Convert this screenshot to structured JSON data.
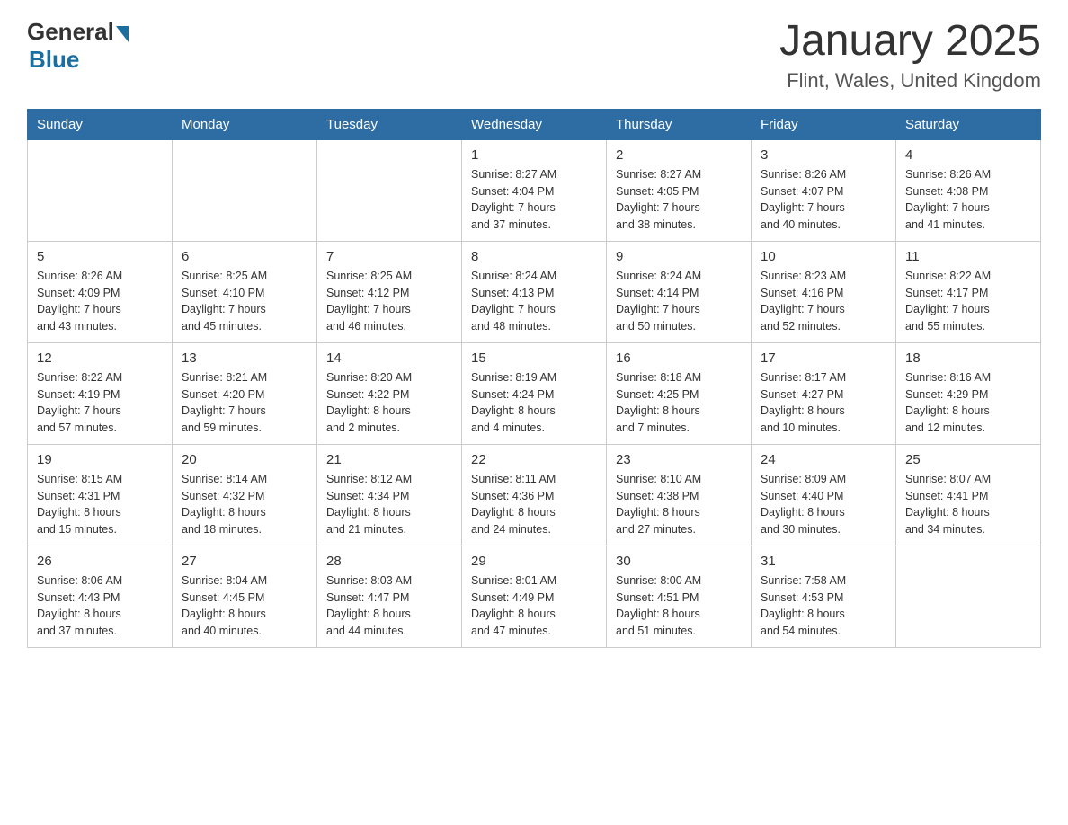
{
  "header": {
    "logo_general": "General",
    "logo_blue": "Blue",
    "title": "January 2025",
    "subtitle": "Flint, Wales, United Kingdom"
  },
  "calendar": {
    "days_of_week": [
      "Sunday",
      "Monday",
      "Tuesday",
      "Wednesday",
      "Thursday",
      "Friday",
      "Saturday"
    ],
    "weeks": [
      [
        {
          "day": "",
          "info": ""
        },
        {
          "day": "",
          "info": ""
        },
        {
          "day": "",
          "info": ""
        },
        {
          "day": "1",
          "info": "Sunrise: 8:27 AM\nSunset: 4:04 PM\nDaylight: 7 hours\nand 37 minutes."
        },
        {
          "day": "2",
          "info": "Sunrise: 8:27 AM\nSunset: 4:05 PM\nDaylight: 7 hours\nand 38 minutes."
        },
        {
          "day": "3",
          "info": "Sunrise: 8:26 AM\nSunset: 4:07 PM\nDaylight: 7 hours\nand 40 minutes."
        },
        {
          "day": "4",
          "info": "Sunrise: 8:26 AM\nSunset: 4:08 PM\nDaylight: 7 hours\nand 41 minutes."
        }
      ],
      [
        {
          "day": "5",
          "info": "Sunrise: 8:26 AM\nSunset: 4:09 PM\nDaylight: 7 hours\nand 43 minutes."
        },
        {
          "day": "6",
          "info": "Sunrise: 8:25 AM\nSunset: 4:10 PM\nDaylight: 7 hours\nand 45 minutes."
        },
        {
          "day": "7",
          "info": "Sunrise: 8:25 AM\nSunset: 4:12 PM\nDaylight: 7 hours\nand 46 minutes."
        },
        {
          "day": "8",
          "info": "Sunrise: 8:24 AM\nSunset: 4:13 PM\nDaylight: 7 hours\nand 48 minutes."
        },
        {
          "day": "9",
          "info": "Sunrise: 8:24 AM\nSunset: 4:14 PM\nDaylight: 7 hours\nand 50 minutes."
        },
        {
          "day": "10",
          "info": "Sunrise: 8:23 AM\nSunset: 4:16 PM\nDaylight: 7 hours\nand 52 minutes."
        },
        {
          "day": "11",
          "info": "Sunrise: 8:22 AM\nSunset: 4:17 PM\nDaylight: 7 hours\nand 55 minutes."
        }
      ],
      [
        {
          "day": "12",
          "info": "Sunrise: 8:22 AM\nSunset: 4:19 PM\nDaylight: 7 hours\nand 57 minutes."
        },
        {
          "day": "13",
          "info": "Sunrise: 8:21 AM\nSunset: 4:20 PM\nDaylight: 7 hours\nand 59 minutes."
        },
        {
          "day": "14",
          "info": "Sunrise: 8:20 AM\nSunset: 4:22 PM\nDaylight: 8 hours\nand 2 minutes."
        },
        {
          "day": "15",
          "info": "Sunrise: 8:19 AM\nSunset: 4:24 PM\nDaylight: 8 hours\nand 4 minutes."
        },
        {
          "day": "16",
          "info": "Sunrise: 8:18 AM\nSunset: 4:25 PM\nDaylight: 8 hours\nand 7 minutes."
        },
        {
          "day": "17",
          "info": "Sunrise: 8:17 AM\nSunset: 4:27 PM\nDaylight: 8 hours\nand 10 minutes."
        },
        {
          "day": "18",
          "info": "Sunrise: 8:16 AM\nSunset: 4:29 PM\nDaylight: 8 hours\nand 12 minutes."
        }
      ],
      [
        {
          "day": "19",
          "info": "Sunrise: 8:15 AM\nSunset: 4:31 PM\nDaylight: 8 hours\nand 15 minutes."
        },
        {
          "day": "20",
          "info": "Sunrise: 8:14 AM\nSunset: 4:32 PM\nDaylight: 8 hours\nand 18 minutes."
        },
        {
          "day": "21",
          "info": "Sunrise: 8:12 AM\nSunset: 4:34 PM\nDaylight: 8 hours\nand 21 minutes."
        },
        {
          "day": "22",
          "info": "Sunrise: 8:11 AM\nSunset: 4:36 PM\nDaylight: 8 hours\nand 24 minutes."
        },
        {
          "day": "23",
          "info": "Sunrise: 8:10 AM\nSunset: 4:38 PM\nDaylight: 8 hours\nand 27 minutes."
        },
        {
          "day": "24",
          "info": "Sunrise: 8:09 AM\nSunset: 4:40 PM\nDaylight: 8 hours\nand 30 minutes."
        },
        {
          "day": "25",
          "info": "Sunrise: 8:07 AM\nSunset: 4:41 PM\nDaylight: 8 hours\nand 34 minutes."
        }
      ],
      [
        {
          "day": "26",
          "info": "Sunrise: 8:06 AM\nSunset: 4:43 PM\nDaylight: 8 hours\nand 37 minutes."
        },
        {
          "day": "27",
          "info": "Sunrise: 8:04 AM\nSunset: 4:45 PM\nDaylight: 8 hours\nand 40 minutes."
        },
        {
          "day": "28",
          "info": "Sunrise: 8:03 AM\nSunset: 4:47 PM\nDaylight: 8 hours\nand 44 minutes."
        },
        {
          "day": "29",
          "info": "Sunrise: 8:01 AM\nSunset: 4:49 PM\nDaylight: 8 hours\nand 47 minutes."
        },
        {
          "day": "30",
          "info": "Sunrise: 8:00 AM\nSunset: 4:51 PM\nDaylight: 8 hours\nand 51 minutes."
        },
        {
          "day": "31",
          "info": "Sunrise: 7:58 AM\nSunset: 4:53 PM\nDaylight: 8 hours\nand 54 minutes."
        },
        {
          "day": "",
          "info": ""
        }
      ]
    ]
  }
}
